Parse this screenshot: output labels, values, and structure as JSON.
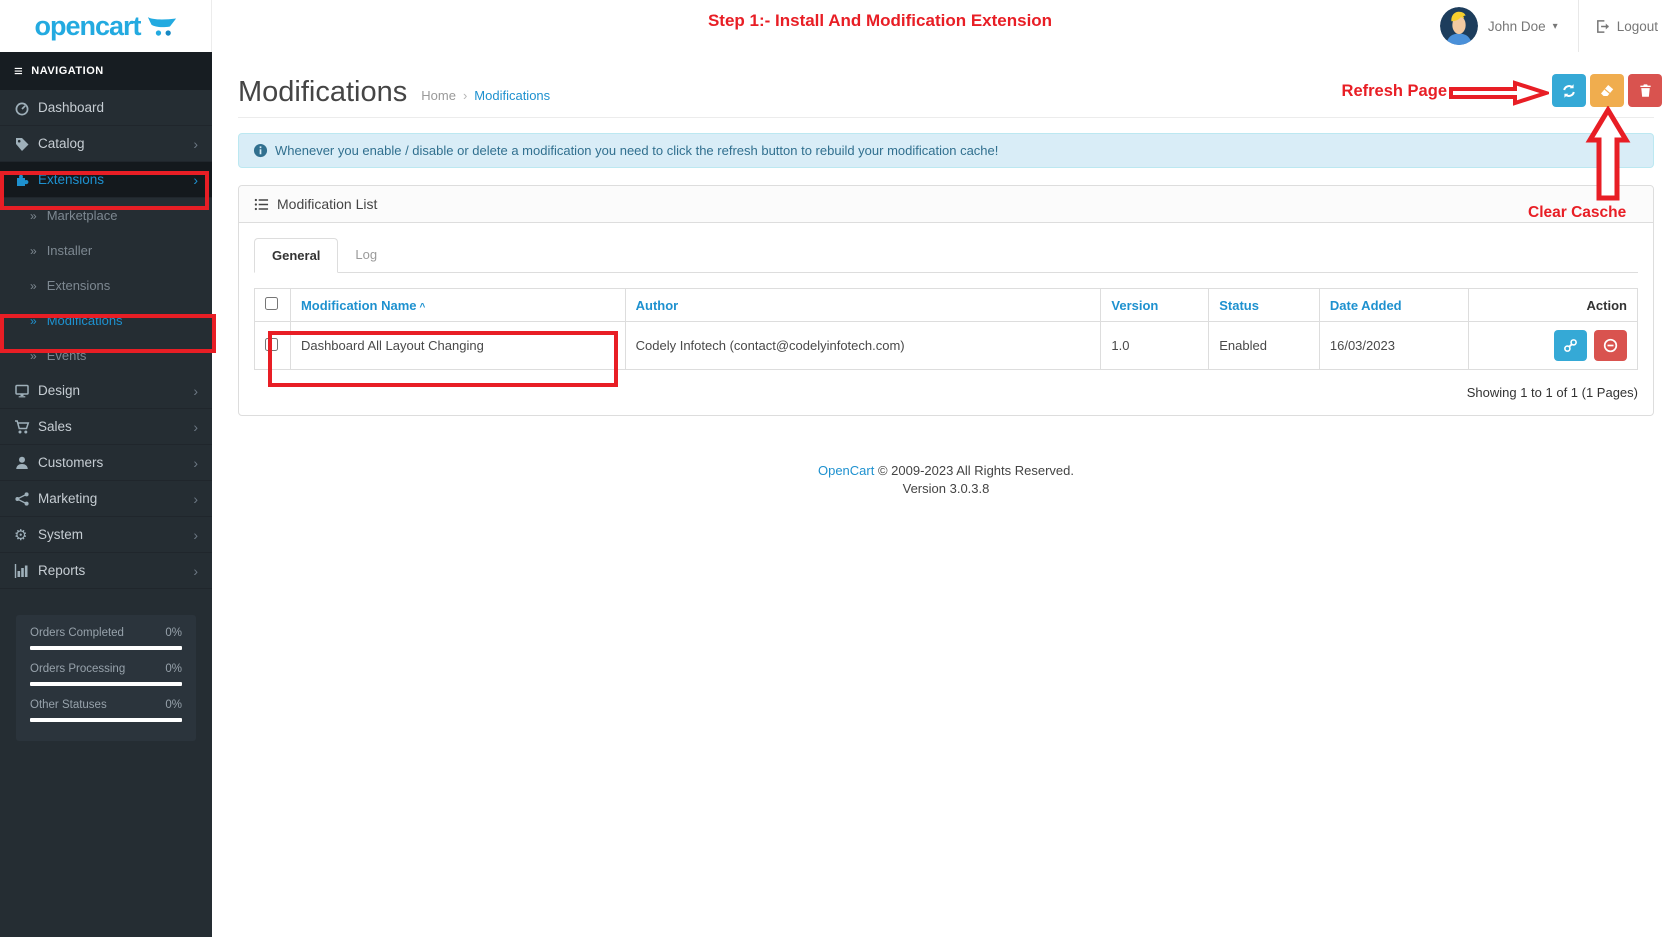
{
  "annotations": {
    "step_title": "Step 1:- Install And Modification Extension",
    "refresh_page_label": "Refresh Page",
    "clear_cache_label": "Clear Casche",
    "highlight_color": "#e81e25"
  },
  "header": {
    "logo_text": "opencart",
    "user_name": "John Doe",
    "logout_label": "Logout"
  },
  "icons": {
    "hamburger": "≡",
    "chevron_right": "›",
    "submenu_arrow": "»",
    "caret_down": "▾",
    "breadcrumb_sep": "›",
    "sort_caret": "^",
    "gear": "⚙"
  },
  "sidebar": {
    "nav_header": "NAVIGATION",
    "items": [
      {
        "label": "Dashboard",
        "icon": "gauge-icon"
      },
      {
        "label": "Catalog",
        "icon": "tags-icon"
      },
      {
        "label": "Extensions",
        "icon": "puzzle-icon"
      },
      {
        "label": "Design",
        "icon": "monitor-icon"
      },
      {
        "label": "Sales",
        "icon": "cart-icon"
      },
      {
        "label": "Customers",
        "icon": "user-icon"
      },
      {
        "label": "Marketing",
        "icon": "share-icon"
      },
      {
        "label": "System",
        "icon": "gear-icon"
      },
      {
        "label": "Reports",
        "icon": "bar-chart-icon"
      }
    ],
    "extensions_submenu": [
      "Marketplace",
      "Installer",
      "Extensions",
      "Modifications",
      "Events"
    ],
    "stats": [
      {
        "label": "Orders Completed",
        "value": "0%"
      },
      {
        "label": "Orders Processing",
        "value": "0%"
      },
      {
        "label": "Other Statuses",
        "value": "0%"
      }
    ]
  },
  "page": {
    "title": "Modifications",
    "breadcrumb": [
      "Home",
      "Modifications"
    ],
    "alert": "Whenever you enable / disable or delete a modification you need to click the refresh button to rebuild your modification cache!",
    "panel_title": "Modification List",
    "tabs": [
      {
        "label": "General"
      },
      {
        "label": "Log"
      }
    ],
    "table": {
      "columns": [
        "Modification Name",
        "Author",
        "Version",
        "Status",
        "Date Added",
        "Action"
      ],
      "sorted_column": "Modification Name",
      "rows": [
        {
          "name": "Dashboard All Layout Changing",
          "author": "Codely Infotech (contact@codelyinfotech.com)",
          "version": "1.0",
          "status": "Enabled",
          "date_added": "16/03/2023"
        }
      ]
    },
    "pagination": "Showing 1 to 1 of 1 (1 Pages)"
  },
  "footer": {
    "link": "OpenCart",
    "copyright": "© 2009-2023 All Rights Reserved.",
    "version": "Version 3.0.3.8"
  },
  "colors": {
    "accent_blue": "#1e91cf",
    "logo_blue": "#23aae0",
    "button_blue": "#35a9d6",
    "button_orange": "#f0ad4e",
    "button_red": "#d9534f",
    "annotation_red": "#e81e25",
    "sidebar_bg": "#252d33",
    "alert_bg": "#d9edf7"
  }
}
